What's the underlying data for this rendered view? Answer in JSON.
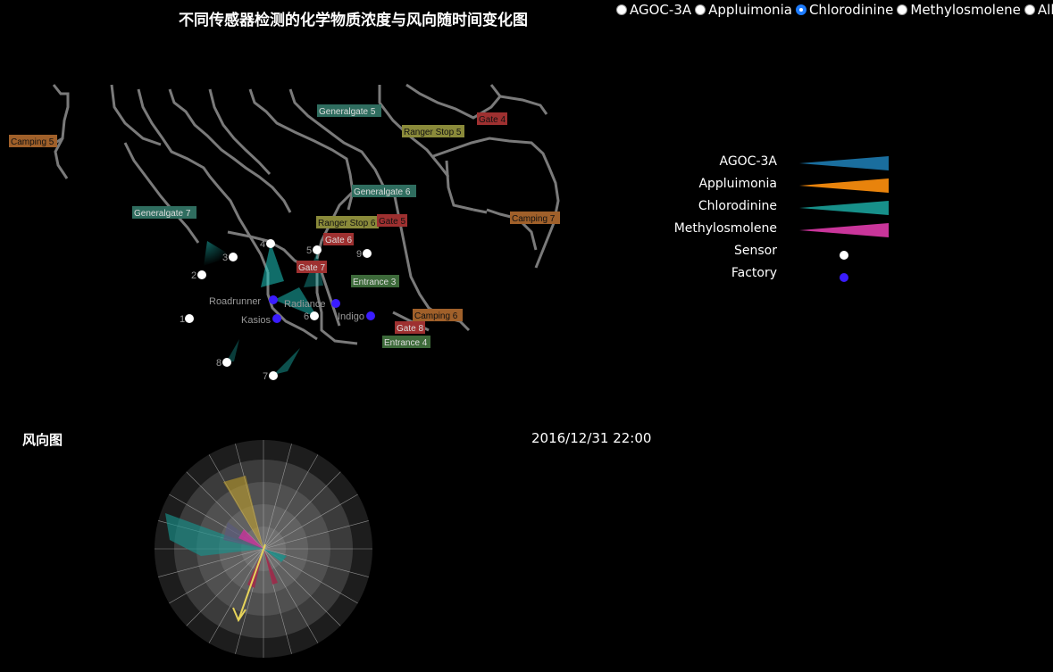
{
  "title": "不同传感器检测的化学物质浓度与风向随时间变化图",
  "chemical_options": [
    {
      "label": "AGOC-3A",
      "selected": false
    },
    {
      "label": "Appluimonia",
      "selected": false
    },
    {
      "label": "Chlorodinine",
      "selected": true
    },
    {
      "label": "Methylosmolene",
      "selected": false
    },
    {
      "label": "All",
      "selected": false
    }
  ],
  "legend": {
    "items": [
      {
        "label": "AGOC-3A",
        "kind": "wedge",
        "color": "#1a6e9e"
      },
      {
        "label": "Appluimonia",
        "kind": "wedge",
        "color": "#e8830c"
      },
      {
        "label": "Chlorodinine",
        "kind": "wedge",
        "color": "#17908a"
      },
      {
        "label": "Methylosmolene",
        "kind": "wedge",
        "color": "#c9359a"
      },
      {
        "label": "Sensor",
        "kind": "dot",
        "color": "#ffffff"
      },
      {
        "label": "Factory",
        "kind": "dot",
        "color": "#3a1cff"
      }
    ]
  },
  "map": {
    "locations": [
      {
        "name": "Camping 5",
        "color": "#a0602a"
      },
      {
        "name": "Generalgate 5",
        "color": "#2f6d5f"
      },
      {
        "name": "Ranger Stop 5",
        "color": "#8a8a3a"
      },
      {
        "name": "Gate 4",
        "color": "#9e3030"
      },
      {
        "name": "Generalgate 6",
        "color": "#2f6d5f"
      },
      {
        "name": "Generalgate 7",
        "color": "#2f6d5f"
      },
      {
        "name": "Ranger Stop 6",
        "color": "#8a8a3a"
      },
      {
        "name": "Gate 5",
        "color": "#9e3030"
      },
      {
        "name": "Camping 7",
        "color": "#a0602a"
      },
      {
        "name": "Gate 6",
        "color": "#9e3030"
      },
      {
        "name": "Gate 7",
        "color": "#9e3030"
      },
      {
        "name": "Entrance 3",
        "color": "#3d6a3a"
      },
      {
        "name": "Camping 6",
        "color": "#a0602a"
      },
      {
        "name": "Gate 8",
        "color": "#9e3030"
      },
      {
        "name": "Entrance 4",
        "color": "#3d6a3a"
      }
    ],
    "sensors": [
      "1",
      "2",
      "3",
      "4",
      "5",
      "6",
      "7",
      "8",
      "9"
    ],
    "factories": [
      "Roadrunner",
      "Kasios",
      "Radiance",
      "Indigo"
    ]
  },
  "wind": {
    "title": "风向图",
    "timestamp": "2016/12/31 22:00"
  }
}
